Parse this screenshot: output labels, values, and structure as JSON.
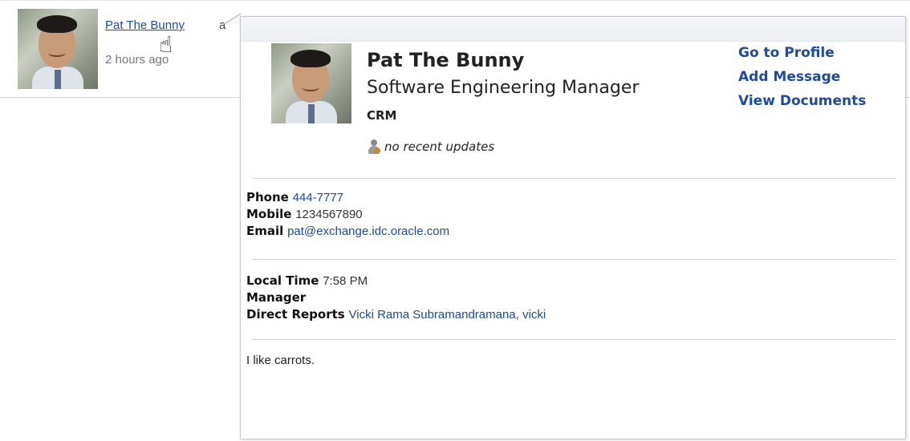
{
  "activity": {
    "author_name": "Pat The Bunny",
    "author_tail": "a",
    "timestamp": "2 hours ago"
  },
  "profile_card": {
    "name": "Pat The Bunny",
    "title": "Software Engineering Manager",
    "department": "CRM",
    "status": "no recent updates",
    "actions": {
      "go_to_profile": "Go to Profile",
      "add_message": "Add Message",
      "view_documents": "View Documents"
    },
    "contact": {
      "phone_label": "Phone",
      "phone": "444-7777",
      "mobile_label": "Mobile",
      "mobile": "1234567890",
      "email_label": "Email",
      "email": "pat@exchange.idc.oracle.com"
    },
    "org": {
      "local_time_label": "Local Time",
      "local_time": "7:58 PM",
      "manager_label": "Manager",
      "direct_reports_label": "Direct Reports",
      "direct_reports": "Vicki Rama Subramandramana, vicki"
    },
    "bio": "I like carrots."
  },
  "icons": {
    "cursor": "hand-pointer-icon",
    "status": "person-presence-icon"
  },
  "colors": {
    "link": "#1e4aa0",
    "divider": "#d5d5d5"
  }
}
